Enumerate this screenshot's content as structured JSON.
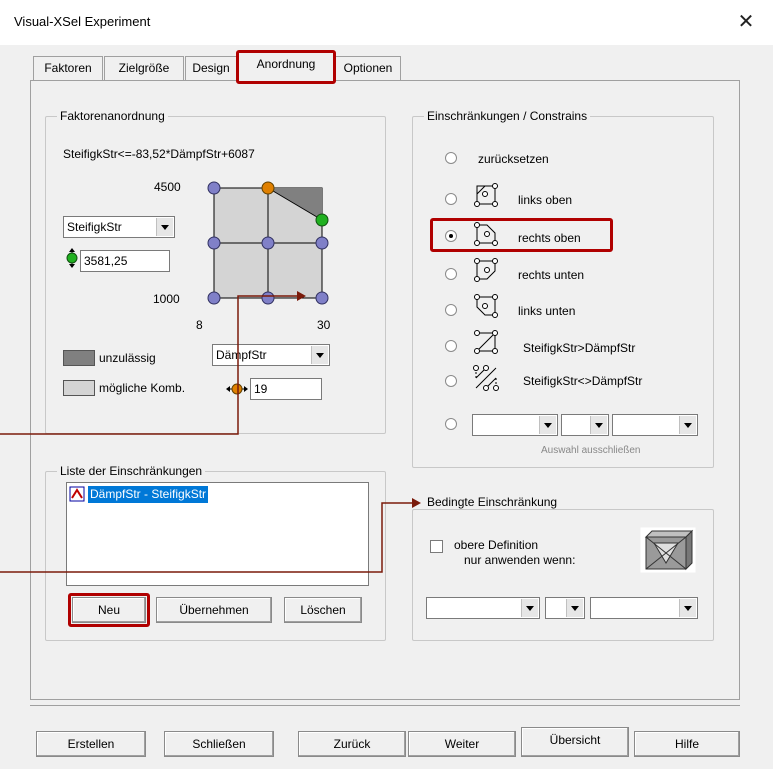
{
  "window": {
    "title": "Visual-XSel  Experiment"
  },
  "tabs": [
    {
      "label": "Faktoren"
    },
    {
      "label": "Zielgröße"
    },
    {
      "label": "Design"
    },
    {
      "label": "Anordnung"
    },
    {
      "label": "Optionen"
    }
  ],
  "factor_group": {
    "title": "Faktorenanordnung",
    "formula": "SteifigkStr<=-83,52*DämpfStr+6087",
    "y_max": "4500",
    "y_min": "1000",
    "x_min": "8",
    "x_max": "30",
    "y_factor": "SteifigkStr",
    "y_value": "3581,25",
    "x_factor": "DämpfStr",
    "x_value": "19",
    "legend_invalid": "unzulässig",
    "legend_possible": "mögliche Komb.",
    "colors": {
      "invalid": "#808080",
      "possible": "#d4d4d4",
      "node": "#8080c8",
      "orange": "#e08000",
      "green": "#20b020"
    }
  },
  "constraints_group": {
    "title": "Einschränkungen / Constrains",
    "options": [
      {
        "label": "zurücksetzen"
      },
      {
        "label": "links oben"
      },
      {
        "label": "rechts oben"
      },
      {
        "label": "rechts unten"
      },
      {
        "label": "links unten"
      },
      {
        "label": "SteifigkStr>DämpfStr"
      },
      {
        "label": "SteifigkStr<>DämpfStr"
      }
    ],
    "exclude_label": "Auswahl ausschließen"
  },
  "list_group": {
    "title": "Liste der Einschränkungen",
    "items": [
      {
        "label": "DämpfStr - SteifigkStr"
      }
    ],
    "btn_new": "Neu",
    "btn_apply": "Übernehmen",
    "btn_delete": "Löschen"
  },
  "conditional_group": {
    "title": "Bedingte Einschränkung",
    "check_line1": "obere Definition",
    "check_line2": "nur anwenden wenn:"
  },
  "footer": {
    "create": "Erstellen",
    "close": "Schließen",
    "back": "Zurück",
    "next": "Weiter",
    "overview": "Übersicht",
    "help": "Hilfe"
  }
}
